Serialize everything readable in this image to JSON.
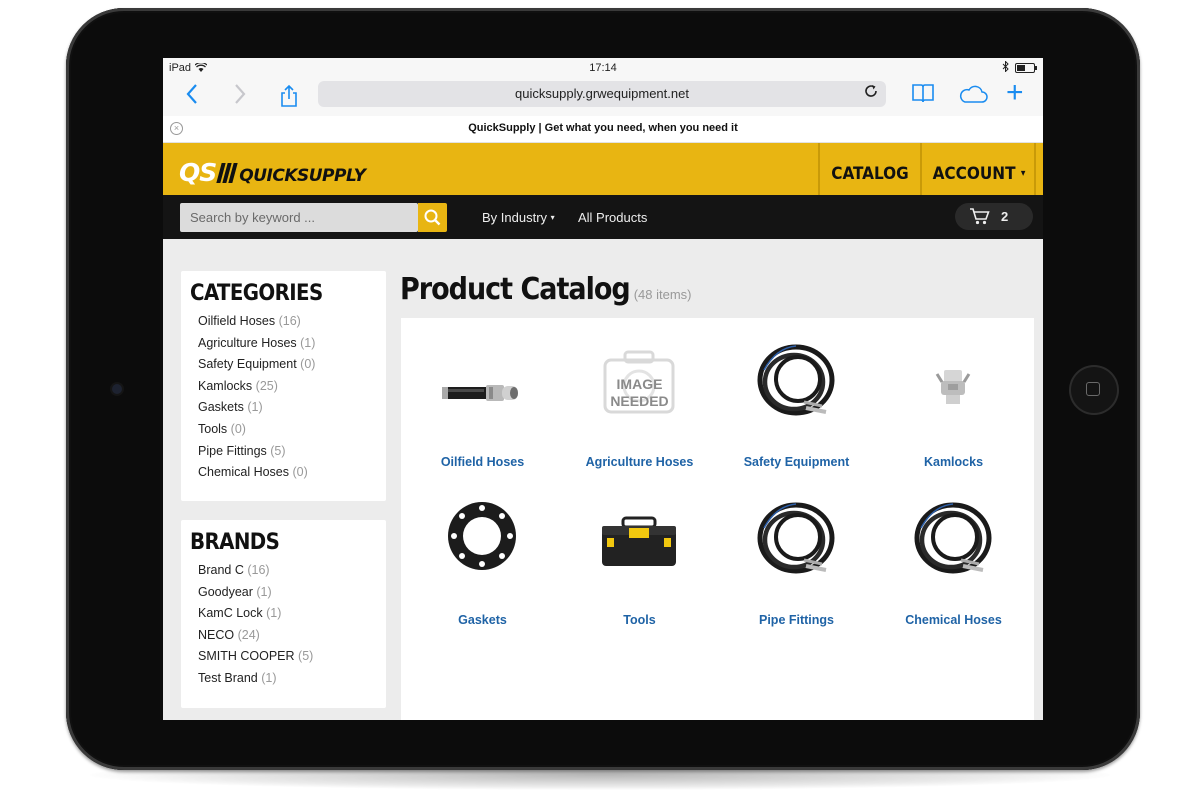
{
  "status_bar": {
    "device": "iPad",
    "time": "17:14"
  },
  "browser": {
    "url": "quicksupply.grwequipment.net",
    "page_title": "QuickSupply | Get what you need, when you need it"
  },
  "header": {
    "logo_initials": "QS",
    "logo_name": "QUICKSUPPLY",
    "nav": [
      {
        "label": "CATALOG"
      },
      {
        "label": "ACCOUNT"
      }
    ]
  },
  "navbar": {
    "search_placeholder": "Search by keyword ...",
    "by_industry": "By Industry",
    "all_products": "All Products",
    "cart_count": "2"
  },
  "sidebar": {
    "categories_title": "CATEGORIES",
    "categories": [
      {
        "name": "Oilfield Hoses",
        "count": "(16)"
      },
      {
        "name": "Agriculture Hoses",
        "count": "(1)"
      },
      {
        "name": "Safety Equipment",
        "count": "(0)"
      },
      {
        "name": "Kamlocks",
        "count": "(25)"
      },
      {
        "name": "Gaskets",
        "count": "(1)"
      },
      {
        "name": "Tools",
        "count": "(0)"
      },
      {
        "name": "Pipe Fittings",
        "count": "(5)"
      },
      {
        "name": "Chemical Hoses",
        "count": "(0)"
      }
    ],
    "brands_title": "BRANDS",
    "brands": [
      {
        "name": "Brand C",
        "count": "(16)"
      },
      {
        "name": "Goodyear",
        "count": "(1)"
      },
      {
        "name": "KamC Lock",
        "count": "(1)"
      },
      {
        "name": "NECO",
        "count": "(24)"
      },
      {
        "name": "SMITH COOPER",
        "count": "(5)"
      },
      {
        "name": "Test Brand",
        "count": "(1)"
      }
    ]
  },
  "main": {
    "title": "Product Catalog",
    "item_count": "(48 items)",
    "products": [
      {
        "label": "Oilfield Hoses",
        "image": "hose-assembly"
      },
      {
        "label": "Agriculture Hoses",
        "image": "image-needed-placeholder",
        "placeholder_text": [
          "IMAGE",
          "NEEDED"
        ]
      },
      {
        "label": "Safety Equipment",
        "image": "coiled-hose"
      },
      {
        "label": "Kamlocks",
        "image": "kamlock-fitting"
      },
      {
        "label": "Gaskets",
        "image": "gasket"
      },
      {
        "label": "Tools",
        "image": "toolbox"
      },
      {
        "label": "Pipe Fittings",
        "image": "coiled-hose"
      },
      {
        "label": "Chemical Hoses",
        "image": "coiled-hose"
      }
    ]
  },
  "colors": {
    "brand_yellow": "#e8b512",
    "link_blue": "#1f63a6",
    "ios_blue": "#1a8cf0"
  }
}
